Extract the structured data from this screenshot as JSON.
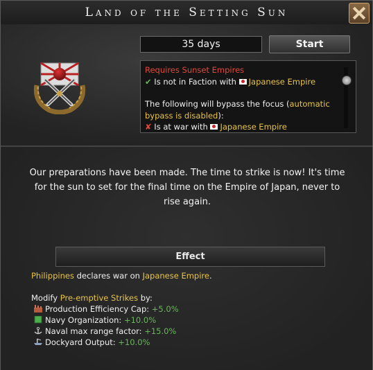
{
  "window": {
    "title": "Land of the Setting Sun"
  },
  "focus": {
    "duration": "35 days",
    "start_label": "Start",
    "requirements": {
      "header": "Requires Sunset Empires",
      "req1_prefix": "Is not in Faction with ",
      "req1_target": "Japanese Empire",
      "bypass_part1": "The following will bypass the focus (",
      "bypass_auto1": "automatic",
      "bypass_auto2": "bypass is disabled",
      "bypass_part2": "):",
      "bypass_prefix": "Is at war with ",
      "bypass_target": "Japanese Empire"
    },
    "description": "Our preparations have been made. The time to strike is now! It's time for the sun to set for the final time on the Empire of Japan, never to rise again.",
    "effect_label": "Effect",
    "effect_country": "Philippines",
    "effect_action": " declares war on ",
    "effect_target": "Japanese Empire",
    "effect_end": ".",
    "modify_prefix": "Modify ",
    "modify_name": "Pre-emptive Strikes",
    "modify_suffix": " by:",
    "modifiers": [
      {
        "label": "Production Efficiency Cap: ",
        "value": "+5.0%",
        "icon": "factory-icon"
      },
      {
        "label": "Navy Organization: ",
        "value": "+10.0%",
        "icon": "green-square-icon"
      },
      {
        "label": "Naval max range factor: ",
        "value": "+15.0%",
        "icon": "anchor-icon"
      },
      {
        "label": "Dockyard Output: ",
        "value": "+10.0%",
        "icon": "dockyard-icon"
      }
    ]
  },
  "colors": {
    "gold": "#e8c44a",
    "red": "#e04a3a",
    "green": "#69b55b"
  }
}
